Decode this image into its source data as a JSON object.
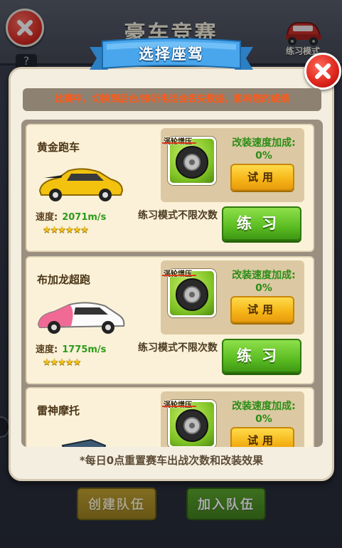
{
  "header": {
    "title": "豪车竞赛",
    "practice_mode_label": "练习模式",
    "help_label": "?"
  },
  "dialog": {
    "title": "选择座驾",
    "warning": "比赛中，切换到后台/接听电话会丢失数据，影响您的成绩",
    "footer_note": "*每日0点重置赛车出战次数和改装效果"
  },
  "cars": [
    {
      "name": "黄金跑车",
      "speed_label": "速度:",
      "speed_value": "2071m/s",
      "stars": "★★★★★★",
      "turbo_tag": "涡轮增压",
      "mod_title": "改装速度加成:",
      "mod_value": "0%",
      "try_label": "试用",
      "practice_note": "练习模式不限次数",
      "practice_label": "练习",
      "color": "#f2c20f"
    },
    {
      "name": "布加龙超跑",
      "speed_label": "速度:",
      "speed_value": "1775m/s",
      "stars": "★★★★★",
      "turbo_tag": "涡轮增压",
      "mod_title": "改装速度加成:",
      "mod_value": "0%",
      "try_label": "试用",
      "practice_note": "练习模式不限次数",
      "practice_label": "练习",
      "color": "#f06a95"
    },
    {
      "name": "雷神摩托",
      "turbo_tag": "涡轮增压",
      "mod_title": "改装速度加成:",
      "mod_value": "0%",
      "try_label": "试用"
    }
  ],
  "bottom": {
    "create_team": "创建队伍",
    "join_team": "加入队伍"
  },
  "icons": {
    "close": "close-icon",
    "tire": "tire-icon",
    "car": "car-icon"
  }
}
